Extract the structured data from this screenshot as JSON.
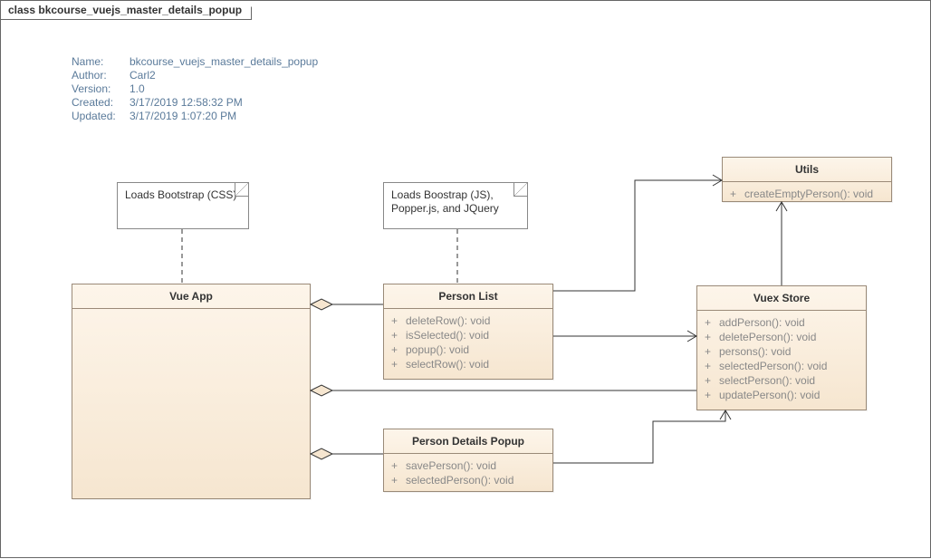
{
  "frame": {
    "title": "class bkcourse_vuejs_master_details_popup"
  },
  "meta": {
    "name_label": "Name:",
    "name_value": "bkcourse_vuejs_master_details_popup",
    "author_label": "Author:",
    "author_value": "Carl2",
    "version_label": "Version:",
    "version_value": "1.0",
    "created_label": "Created:",
    "created_value": "3/17/2019 12:58:32 PM",
    "updated_label": "Updated:",
    "updated_value": "3/17/2019 1:07:20 PM"
  },
  "notes": {
    "vueapp": "Loads Bootstrap (CSS)",
    "personlist": "Loads Boostrap (JS), Popper.js, and JQuery"
  },
  "classes": {
    "vueapp": {
      "title": "Vue App"
    },
    "personlist": {
      "title": "Person List",
      "ops": [
        "deleteRow(): void",
        "isSelected(): void",
        "popup(): void",
        "selectRow(): void"
      ]
    },
    "persondetails": {
      "title": "Person Details Popup",
      "ops": [
        "savePerson(): void",
        "selectedPerson(): void"
      ]
    },
    "vuexstore": {
      "title": "Vuex Store",
      "ops": [
        "addPerson(): void",
        "deletePerson(): void",
        "persons(): void",
        "selectedPerson(): void",
        "selectPerson(): void",
        "updatePerson(): void"
      ]
    },
    "utils": {
      "title": "Utils",
      "ops": [
        "createEmptyPerson(): void"
      ]
    }
  }
}
